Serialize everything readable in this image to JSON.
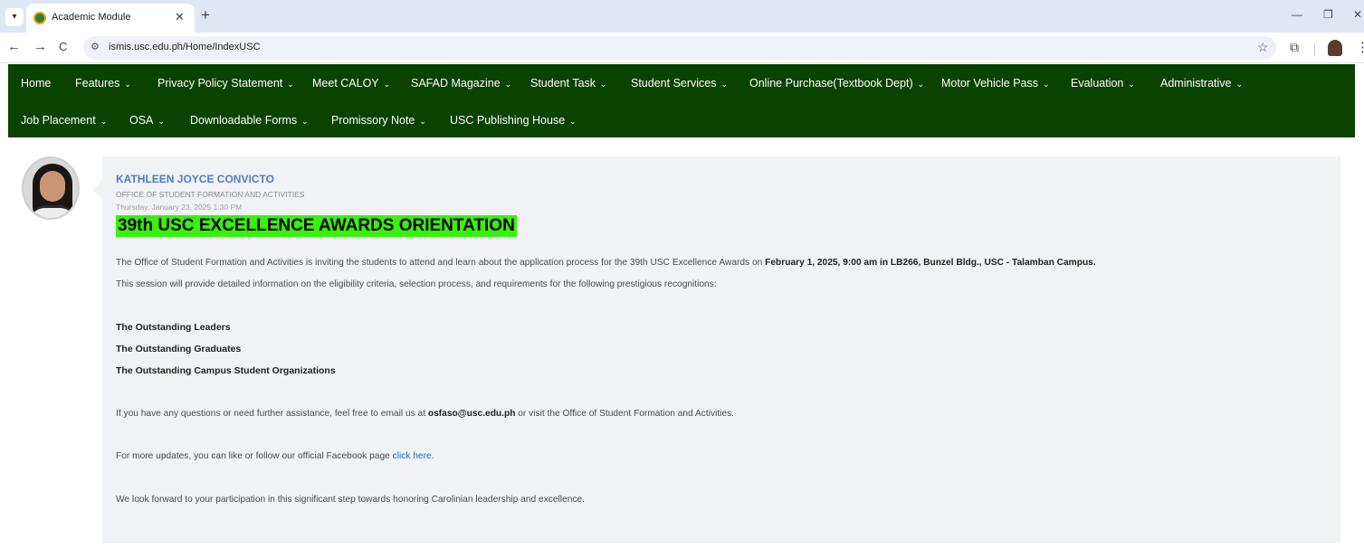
{
  "browser": {
    "tab_title": "Academic Module",
    "url": "ismis.usc.edu.ph/Home/IndexUSC",
    "icons": {
      "tab_menu": "▾",
      "tab_close": "✕",
      "new_tab": "+",
      "minimize": "—",
      "restore": "❐",
      "close": "✕",
      "back": "←",
      "forward": "→",
      "reload": "C",
      "site_info": "⚙",
      "star": "☆",
      "extensions": "⧉",
      "more": "⋮"
    }
  },
  "nav": {
    "row1": [
      {
        "label": "Home",
        "dropdown": false
      },
      {
        "label": "Features",
        "dropdown": true
      },
      {
        "label": "Privacy Policy Statement",
        "dropdown": true
      },
      {
        "label": "Meet CALOY",
        "dropdown": true
      },
      {
        "label": "SAFAD Magazine",
        "dropdown": true
      },
      {
        "label": "Student Task",
        "dropdown": true
      },
      {
        "label": "Student Services",
        "dropdown": true
      },
      {
        "label": "Online Purchase(Textbook Dept)",
        "dropdown": true
      },
      {
        "label": "Motor Vehicle Pass",
        "dropdown": true
      },
      {
        "label": "Evaluation",
        "dropdown": true
      },
      {
        "label": "Administrative",
        "dropdown": true
      }
    ],
    "row2": [
      {
        "label": "Job Placement",
        "dropdown": true
      },
      {
        "label": "OSA",
        "dropdown": true
      },
      {
        "label": "Downloadable Forms",
        "dropdown": true
      },
      {
        "label": "Promissory Note",
        "dropdown": true
      },
      {
        "label": "USC Publishing House",
        "dropdown": true
      }
    ],
    "chevron": "⌄"
  },
  "post": {
    "author": "KATHLEEN JOYCE CONVICTO",
    "office": "OFFICE OF STUDENT FORMATION AND ACTIVITIES",
    "date": "Thursday, January 23, 2025 1:30 PM",
    "headline": "39th USC EXCELLENCE AWARDS ORIENTATION",
    "intro_text": "The Office of Student Formation and Activities is inviting the students to attend and learn about the application process for the 39th USC Excellence Awards on ",
    "intro_bold": "February 1, 2025, 9:00 am in LB266, Bunzel Bldg., USC - Talamban Campus.",
    "session_text": "This session will provide detailed information on the eligibility criteria, selection process, and requirements for the following prestigious recognitions:",
    "awards": [
      "The Outstanding Leaders",
      "The Outstanding Graduates",
      "The Outstanding Campus Student Organizations"
    ],
    "questions_pre": "If you have any questions or need further assistance, feel free to email us at ",
    "email": "osfaso@usc.edu.ph",
    "questions_post": " or visit the Office of Student Formation and Activities.",
    "updates_pre": "For more updates, you can like or follow our official Facebook page ",
    "updates_link": "click here",
    "updates_post": ".",
    "closing": "We look forward to your participation in this significant step towards honoring Carolinian leadership and excellence."
  },
  "colors": {
    "nav_bg": "#0a4300",
    "headline_highlight": "#3af00e",
    "author": "#4f7fbf",
    "link": "#1c66d1",
    "post_bg": "#f0f2f6"
  }
}
